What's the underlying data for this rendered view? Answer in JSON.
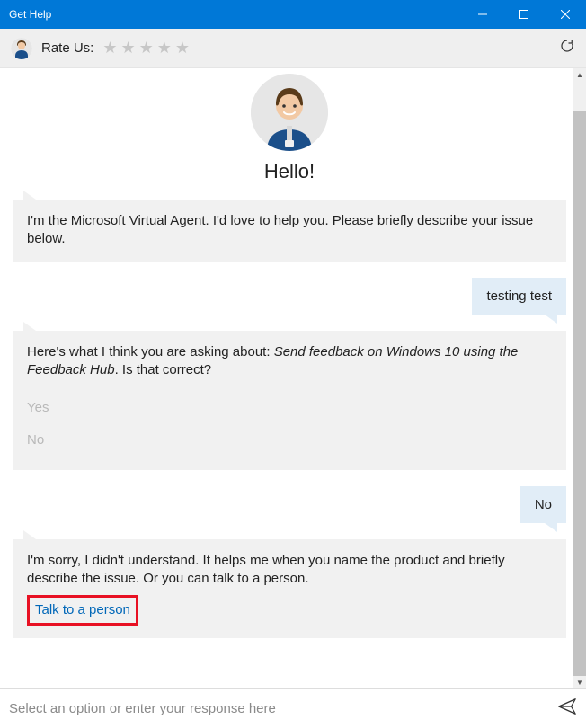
{
  "titlebar": {
    "title": "Get Help"
  },
  "ratebar": {
    "label": "Rate Us:"
  },
  "hero": {
    "greeting": "Hello!"
  },
  "messages": {
    "intro": "I'm the Microsoft Virtual Agent. I'd love to help you. Please briefly describe your issue below.",
    "user1": "testing test",
    "guess_prefix": "Here's what I think you are asking about: ",
    "guess_topic": "Send feedback on Windows 10 using the Feedback Hub",
    "guess_suffix": ". Is that correct?",
    "opt_yes": "Yes",
    "opt_no": "No",
    "user2": "No",
    "sorry": "I'm sorry, I didn't understand. It helps me when you name the product and briefly describe the issue. Or you can talk to a person.",
    "talk_link": "Talk to a person"
  },
  "input": {
    "placeholder": "Select an option or enter your response here"
  }
}
